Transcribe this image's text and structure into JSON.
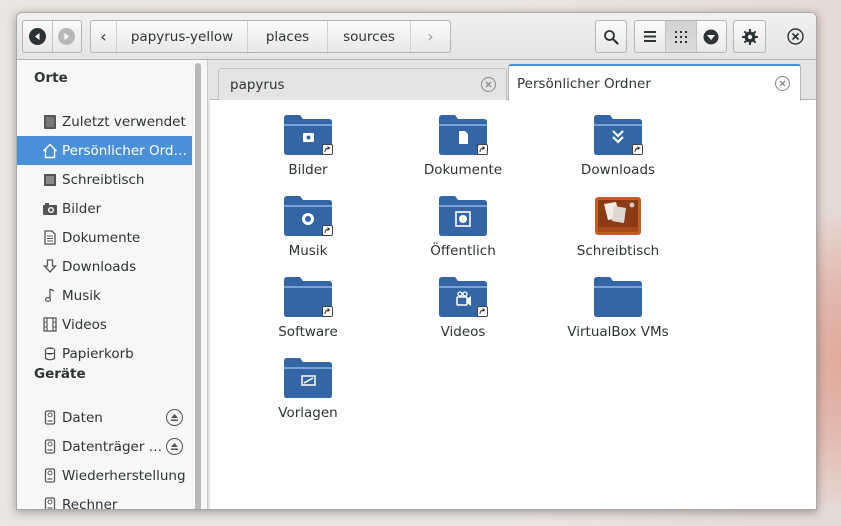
{
  "headerbar": {
    "path": [
      "papyrus-yellow",
      "places",
      "sources"
    ],
    "path_left_arrow": "‹",
    "path_right_arrow": "›"
  },
  "sidebar": {
    "places_heading": "Orte",
    "places": [
      {
        "label": "Zuletzt verwendet",
        "icon": "clock-icon"
      },
      {
        "label": "Persönlicher Ord…",
        "icon": "home-icon",
        "selected": true
      },
      {
        "label": "Schreibtisch",
        "icon": "desktop-icon"
      },
      {
        "label": "Bilder",
        "icon": "camera-icon"
      },
      {
        "label": "Dokumente",
        "icon": "document-icon"
      },
      {
        "label": "Downloads",
        "icon": "download-icon"
      },
      {
        "label": "Musik",
        "icon": "music-note-icon"
      },
      {
        "label": "Videos",
        "icon": "film-icon"
      },
      {
        "label": "Papierkorb",
        "icon": "trash-icon"
      }
    ],
    "devices_heading": "Geräte",
    "devices": [
      {
        "label": "Daten",
        "icon": "drive-icon",
        "eject": true
      },
      {
        "label": "Datenträger …",
        "icon": "drive-icon",
        "eject": true
      },
      {
        "label": "Wiederherstellung",
        "icon": "drive-icon",
        "eject": false
      },
      {
        "label": "Rechner",
        "icon": "drive-icon",
        "eject": false
      }
    ]
  },
  "tabs": [
    {
      "label": "papyrus",
      "active": false
    },
    {
      "label": "Persönlicher Ordner",
      "active": true
    }
  ],
  "files": [
    {
      "name": "Bilder",
      "icon": "pictures-folder-icon"
    },
    {
      "name": "Dokumente",
      "icon": "documents-folder-icon"
    },
    {
      "name": "Downloads",
      "icon": "downloads-folder-icon"
    },
    {
      "name": "Musik",
      "icon": "music-folder-icon"
    },
    {
      "name": "Öffentlich",
      "icon": "public-folder-icon"
    },
    {
      "name": "Schreibtisch",
      "icon": "desktop-folder-icon"
    },
    {
      "name": "Software",
      "icon": "software-folder-icon"
    },
    {
      "name": "Videos",
      "icon": "videos-folder-icon"
    },
    {
      "name": "VirtualBox VMs",
      "icon": "folder-icon"
    },
    {
      "name": "Vorlagen",
      "icon": "templates-folder-icon"
    }
  ],
  "colors": {
    "accent": "#4a90d9",
    "folder": "#3465a4",
    "desktop_folder": "#c65d25"
  }
}
